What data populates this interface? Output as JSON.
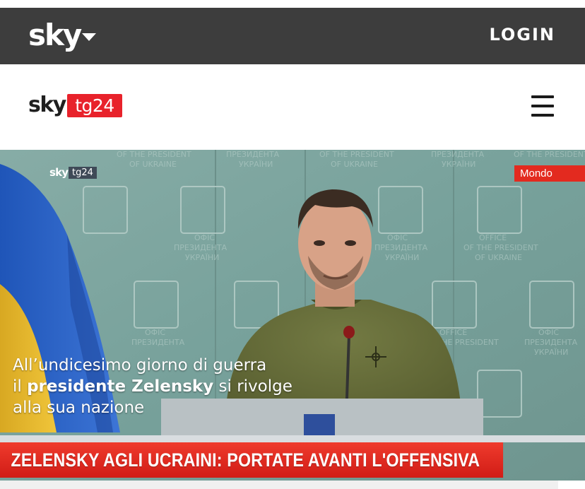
{
  "topbar": {
    "brand": "sky",
    "login_label": "LOGIN"
  },
  "header": {
    "logo_sky": "sky",
    "logo_tg": "tg24",
    "menu_icon": "hamburger-menu-icon"
  },
  "video": {
    "watermark_sky": "sky",
    "watermark_tg": "tg24",
    "category_badge": "Mondo",
    "caption_line1": "All’undicesimo giorno di guerra",
    "caption_line2_prefix": "il ",
    "caption_line2_bold": "presidente Zelensky",
    "caption_line2_suffix": " si rivolge",
    "caption_line3": "alla sua nazione",
    "headline": "ZELENSKY AGLI UCRAINI: PORTATE AVANTI L'OFFENSIVA",
    "backdrop_text": [
      "OF THE PRESIDENT",
      "OF UKRAINE",
      "ПРЕЗИДЕНТА",
      "УКРАЇНИ",
      "ОФІС"
    ]
  },
  "colors": {
    "topbar_bg": "#3d3d3d",
    "accent_red": "#e8222b",
    "headline_red": "#e32a1f"
  }
}
